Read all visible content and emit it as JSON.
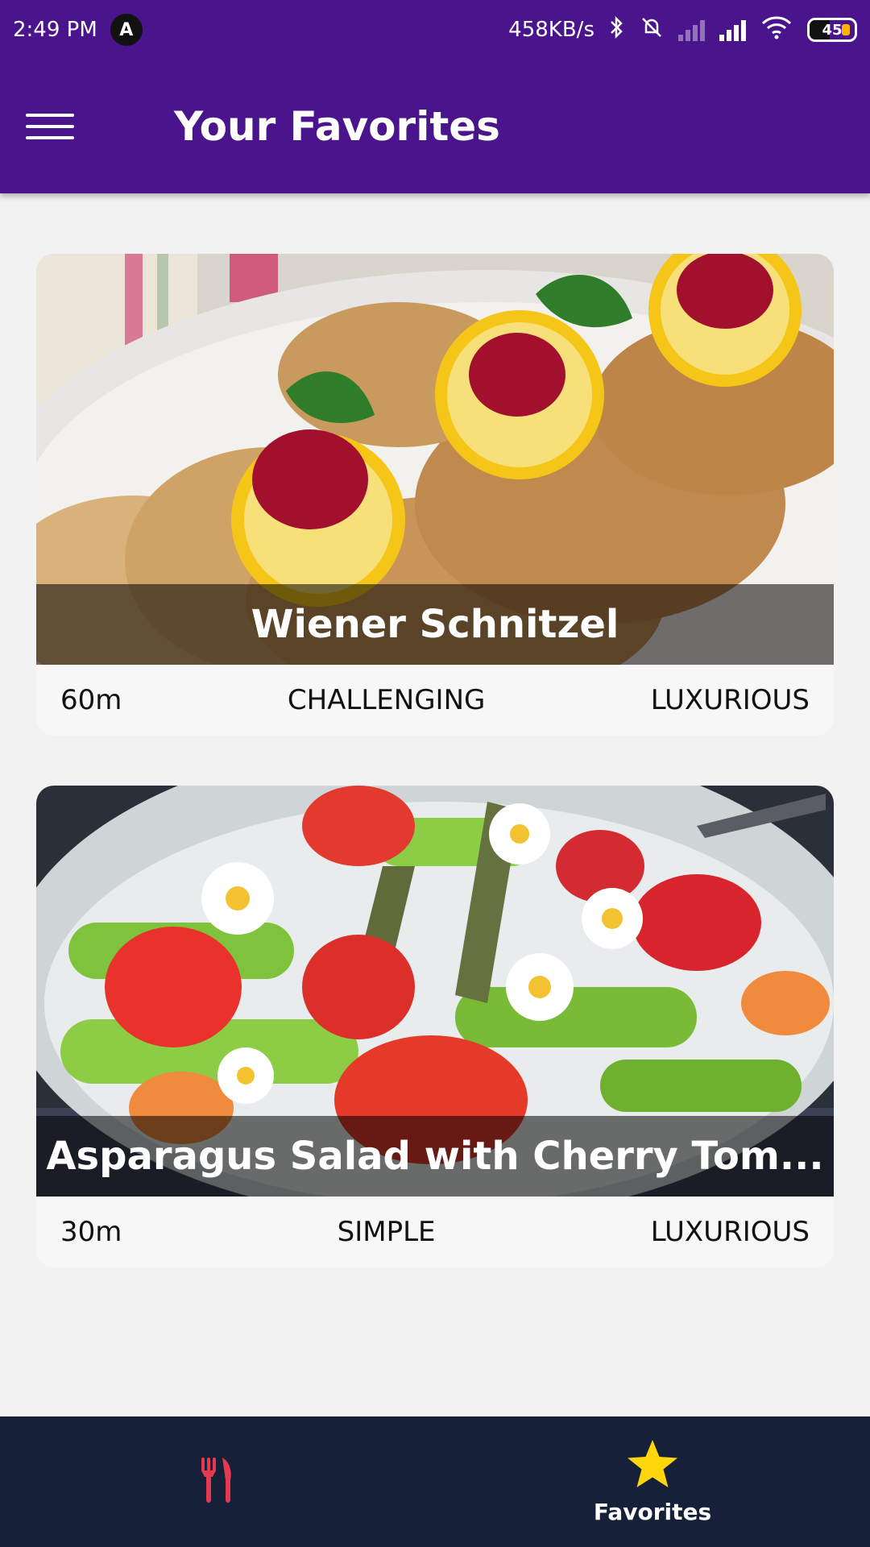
{
  "status_bar": {
    "time": "2:49 PM",
    "app_icon": "A",
    "speed": "458KB/s",
    "battery": "45"
  },
  "app_bar": {
    "title": "Your Favorites",
    "menu_icon": "hamburger-menu-icon"
  },
  "favorites": [
    {
      "title": "Wiener Schnitzel",
      "duration": "60m",
      "complexity": "CHALLENGING",
      "affordability": "LUXURIOUS"
    },
    {
      "title": "Asparagus Salad with Cherry Tom...",
      "duration": "30m",
      "complexity": "SIMPLE",
      "affordability": "LUXURIOUS"
    }
  ],
  "bottom_nav": {
    "items": [
      {
        "icon": "fork-knife-icon",
        "label": "",
        "color": "#e53950"
      },
      {
        "icon": "star-icon",
        "label": "Favorites",
        "color": "#ffd60a"
      }
    ]
  },
  "colors": {
    "primary": "#4a148c",
    "nav_background": "#172039",
    "accent_star": "#ffd60a",
    "accent_meals": "#e53950"
  }
}
